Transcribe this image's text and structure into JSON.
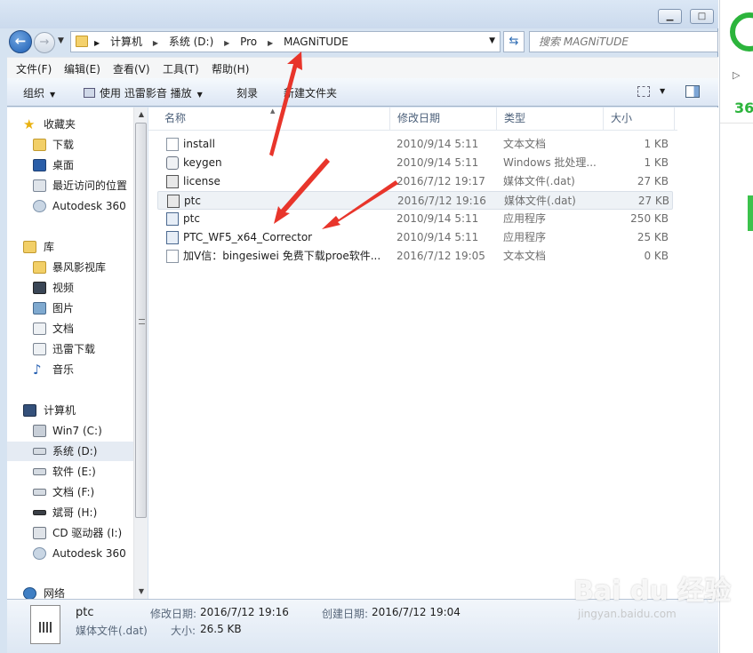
{
  "address": {
    "crumbs": [
      "计算机",
      "系统 (D:)",
      "Pro",
      "MAGNiTUDE"
    ],
    "search_placeholder": "搜索 MAGNiTUDE"
  },
  "menubar": [
    "文件(F)",
    "编辑(E)",
    "查看(V)",
    "工具(T)",
    "帮助(H)"
  ],
  "toolbar": {
    "organize": "组织",
    "open_with": "使用 迅雷影音 播放",
    "burn": "刻录",
    "new_folder": "新建文件夹"
  },
  "navpane": {
    "favorites": {
      "header": "收藏夹",
      "items": [
        "下载",
        "桌面",
        "最近访问的位置",
        "Autodesk 360"
      ]
    },
    "libraries": {
      "header": "库",
      "items": [
        "暴风影视库",
        "视频",
        "图片",
        "文档",
        "迅雷下载",
        "音乐"
      ]
    },
    "computer": {
      "header": "计算机",
      "items": [
        "Win7 (C:)",
        "系统 (D:)",
        "软件 (E:)",
        "文档 (F:)",
        "斌哥 (H:)",
        "CD 驱动器 (I:)",
        "Autodesk 360"
      ],
      "selected_index": 1
    },
    "network": {
      "header": "网络"
    }
  },
  "columns": {
    "name": "名称",
    "date": "修改日期",
    "type": "类型",
    "size": "大小"
  },
  "files": [
    {
      "name": "install",
      "date": "2010/9/14 5:11",
      "type": "文本文档",
      "size": "1 KB",
      "icon": "text-file-icon"
    },
    {
      "name": "keygen",
      "date": "2010/9/14 5:11",
      "type": "Windows 批处理...",
      "size": "1 KB",
      "icon": "batch-file-icon"
    },
    {
      "name": "license",
      "date": "2016/7/12 19:17",
      "type": "媒体文件(.dat)",
      "size": "27 KB",
      "icon": "dat-file-icon"
    },
    {
      "name": "ptc",
      "date": "2016/7/12 19:16",
      "type": "媒体文件(.dat)",
      "size": "27 KB",
      "icon": "dat-file-icon"
    },
    {
      "name": "ptc",
      "date": "2010/9/14 5:11",
      "type": "应用程序",
      "size": "250 KB",
      "icon": "application-icon"
    },
    {
      "name": "PTC_WF5_x64_Corrector",
      "date": "2010/9/14 5:11",
      "type": "应用程序",
      "size": "25 KB",
      "icon": "application-icon"
    },
    {
      "name": "加V信：bingesiwei 免费下载proe软件...",
      "date": "2016/7/12 19:05",
      "type": "文本文档",
      "size": "0 KB",
      "icon": "text-file-icon"
    }
  ],
  "selected_file_index": 3,
  "details": {
    "name": "ptc",
    "type": "媒体文件(.dat)",
    "modified_label": "修改日期:",
    "modified": "2016/7/12 19:16",
    "created_label": "创建日期:",
    "created": "2016/7/12 19:04",
    "size_label": "大小:",
    "size": "26.5 KB"
  },
  "right_panel": {
    "brand_text": "36"
  },
  "watermark": {
    "main": "Bai du 经验",
    "sub": "jingyan.baidu.com"
  },
  "colors": {
    "annotation_arrow": "#e8352b",
    "brand_green": "#2cb43c",
    "selection": "#e5ebf3"
  }
}
